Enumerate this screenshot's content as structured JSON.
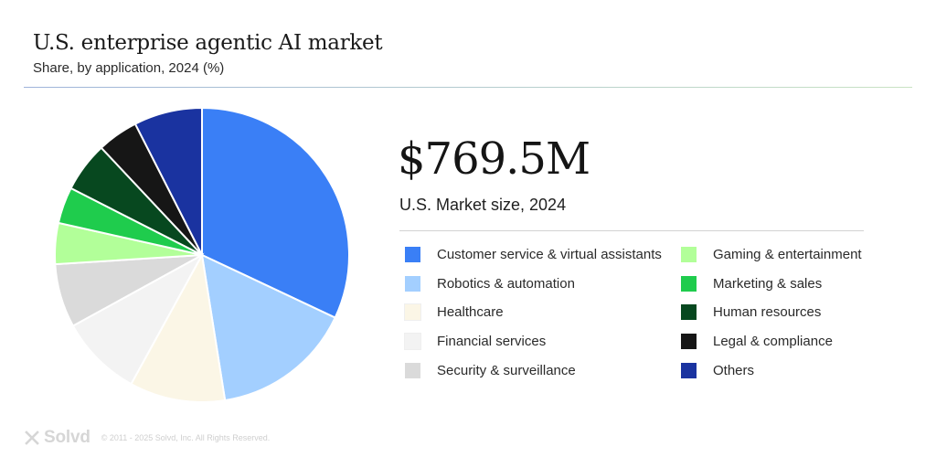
{
  "header": {
    "title": "U.S. enterprise agentic AI market",
    "subtitle": "Share, by application, 2024 (%)"
  },
  "market": {
    "value": "$769.5M",
    "label": "U.S. Market size, 2024"
  },
  "chart_data": {
    "type": "pie",
    "title": "U.S. enterprise agentic AI market",
    "subtitle": "Share, by application, 2024 (%)",
    "slices": [
      {
        "label": "Customer service & virtual assistants",
        "value": 32.0,
        "color": "#3a7ff6"
      },
      {
        "label": "Robotics & automation",
        "value": 15.5,
        "color": "#a3cfff"
      },
      {
        "label": "Healthcare",
        "value": 10.5,
        "color": "#fbf6e6"
      },
      {
        "label": "Financial services",
        "value": 9.0,
        "color": "#f3f3f3"
      },
      {
        "label": "Security & surveillance",
        "value": 7.0,
        "color": "#dadada"
      },
      {
        "label": "Gaming & entertainment",
        "value": 4.5,
        "color": "#b2ff99"
      },
      {
        "label": "Marketing & sales",
        "value": 4.0,
        "color": "#1fcc4d"
      },
      {
        "label": "Human resources",
        "value": 5.5,
        "color": "#07481f"
      },
      {
        "label": "Legal & compliance",
        "value": 4.5,
        "color": "#161616"
      },
      {
        "label": "Others",
        "value": 7.5,
        "color": "#1a33a0"
      }
    ],
    "legend_position": "right"
  },
  "footer": {
    "brand": "Solvd",
    "copyright": "© 2011 - 2025 Solvd, Inc. All Rights Reserved."
  }
}
